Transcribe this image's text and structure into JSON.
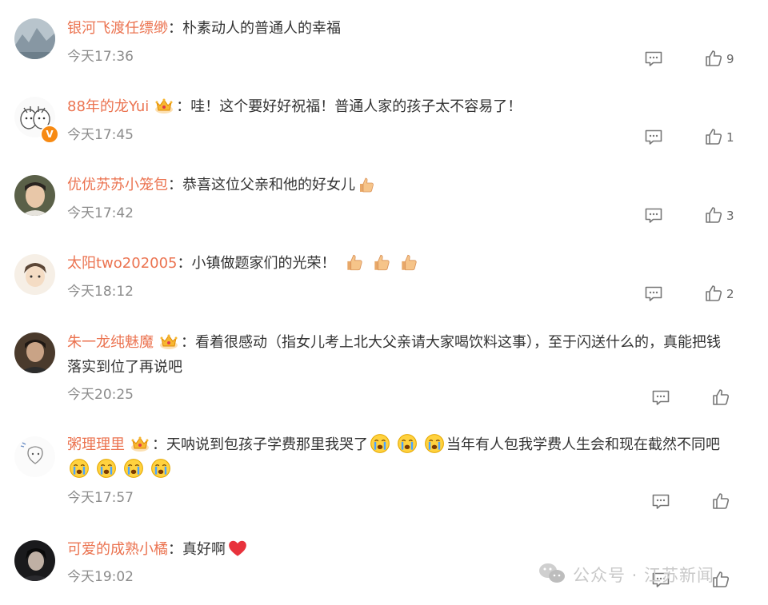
{
  "comments": [
    {
      "name": "银河飞渡任缥缈",
      "text": "朴素动人的普通人的幸福",
      "time": "今天17:36",
      "likes": "9"
    },
    {
      "name": "88年的龙Yui",
      "text": "哇！这个要好好祝福！普通人家的孩子太不容易了！",
      "time": "今天17:45",
      "likes": "1"
    },
    {
      "name": "优优苏苏小笼包",
      "text": "恭喜这位父亲和他的好女儿",
      "time": "今天17:42",
      "likes": "3"
    },
    {
      "name": "太阳two202005",
      "text": "小镇做题家们的光荣！",
      "time": "今天18:12",
      "likes": "2"
    },
    {
      "name": "朱一龙纯魅魔",
      "text_line1": "看着很感动（指女儿考上北大父亲请大家喝饮料这事），至于闪送什么的，真能把钱",
      "text_line2": "落实到位了再说吧",
      "time": "今天20:25",
      "likes": ""
    },
    {
      "name": "粥理理里",
      "text_part1": "天呐说到包孩子学费那里我哭了",
      "text_part2": "当年有人包我学费人生会和现在截然不同吧",
      "time": "今天17:57",
      "likes": ""
    },
    {
      "name": "可爱的成熟小橘",
      "text": "真好啊",
      "time": "今天19:02",
      "likes": ""
    }
  ],
  "separator": "：",
  "badge": {
    "vip": "V"
  },
  "watermark": {
    "text": "公众号 · 江苏新闻"
  },
  "icons": {
    "reply": "comment-icon",
    "like": "thumbs-up-icon",
    "crown": "crown-badge-icon",
    "emoji_thumb": "thumbs-up-emoji",
    "emoji_cry": "crying-emoji",
    "emoji_heart": "red-heart-emoji"
  },
  "colors": {
    "name": "#eb7350",
    "text": "#333333",
    "time": "#8c8c8c",
    "icon": "#777777",
    "accent": "#f78a13"
  }
}
